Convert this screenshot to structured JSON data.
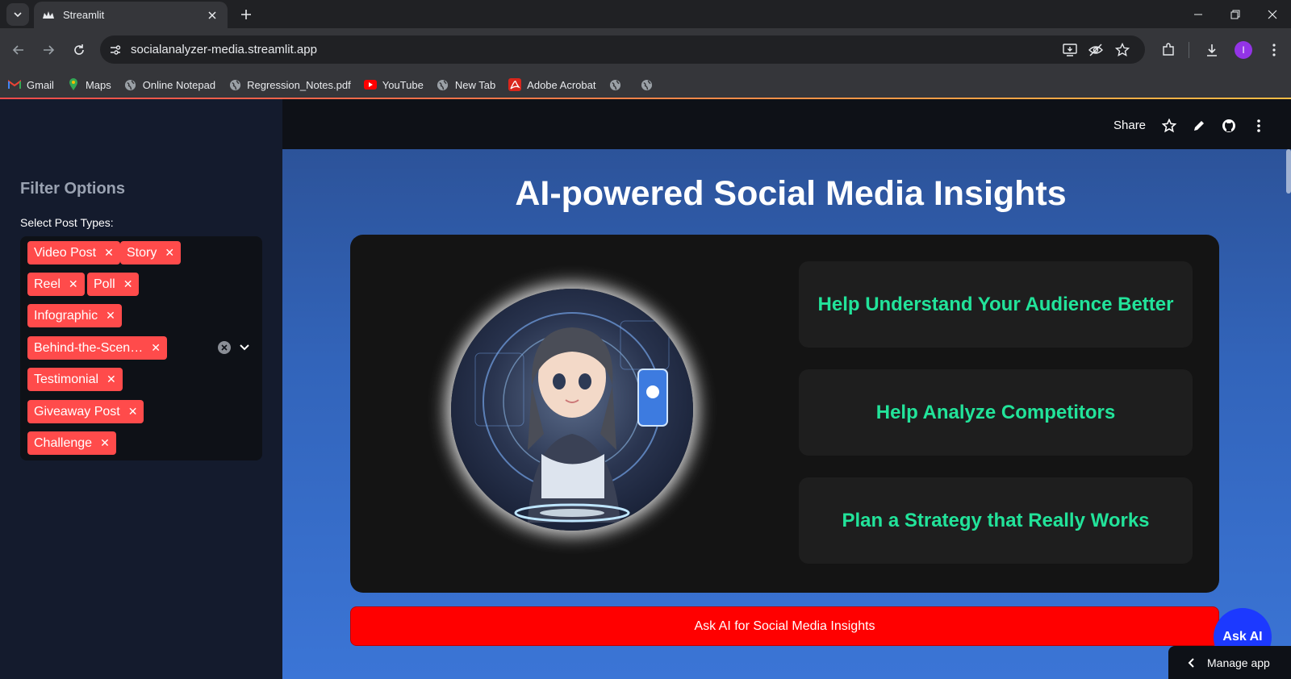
{
  "browser": {
    "tab_title": "Streamlit",
    "url": "socialanalyzer-media.streamlit.app",
    "profile_initial": "I",
    "bookmarks": [
      {
        "label": "Gmail",
        "icon": "gmail-icon"
      },
      {
        "label": "Maps",
        "icon": "maps-icon"
      },
      {
        "label": "Online Notepad",
        "icon": "globe-icon"
      },
      {
        "label": "Regression_Notes.pdf",
        "icon": "globe-icon"
      },
      {
        "label": "YouTube",
        "icon": "youtube-icon"
      },
      {
        "label": "New Tab",
        "icon": "globe-icon"
      },
      {
        "label": "Adobe Acrobat",
        "icon": "acrobat-icon"
      },
      {
        "label": "",
        "icon": "globe-icon"
      },
      {
        "label": "",
        "icon": "globe-icon"
      }
    ]
  },
  "sidebar": {
    "title": "Filter Options",
    "label": "Select Post Types:",
    "chips": [
      "Video Post",
      "Story",
      "Reel",
      "Poll",
      "Infographic",
      "Behind-the-Scen…",
      "Testimonial",
      "Giveaway Post",
      "Challenge"
    ]
  },
  "header": {
    "share_label": "Share"
  },
  "main": {
    "title": "AI-powered Social Media Insights",
    "features": [
      "Help Understand Your Audience Better",
      "Help Analyze Competitors",
      "Plan a Strategy that Really Works"
    ],
    "ask_button": "Ask AI for Social Media Insights",
    "ask_fab": "Ask AI",
    "manage_app": "Manage app"
  },
  "colors": {
    "accent_red": "#ff4b4b",
    "feature_green": "#22e39a",
    "ask_bar_red": "#ff0000",
    "ask_fab_blue": "#1c39ff"
  }
}
